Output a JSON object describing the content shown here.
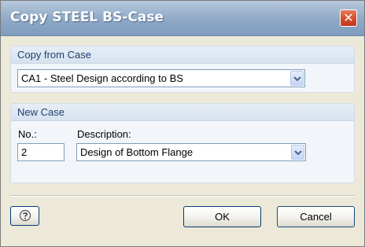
{
  "window": {
    "title": "Copy STEEL BS-Case",
    "close_glyph": "✕"
  },
  "copy_from": {
    "header": "Copy from Case",
    "selected": "CA1 - Steel Design according to BS"
  },
  "new_case": {
    "header": "New Case",
    "no_label": "No.:",
    "no_value": "2",
    "description_label": "Description:",
    "description_value": "Design of Bottom Flange"
  },
  "buttons": {
    "ok": "OK",
    "cancel": "Cancel",
    "help_icon": "help-icon"
  },
  "colors": {
    "titlebar": "#8ea8c6",
    "close": "#d0482a",
    "group_header_text": "#1f3f6d",
    "dialog_bg": "#ece9d8"
  }
}
